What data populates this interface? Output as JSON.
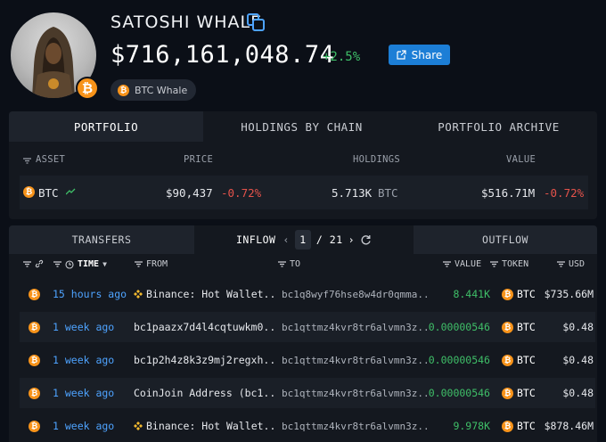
{
  "entity": {
    "name": "SATOSHI WHALE",
    "balance": "$716,161,048.74",
    "change": "+2.5%",
    "share_label": "Share",
    "tag_label": "BTC Whale",
    "avatar_badge": "₿"
  },
  "portfolio_tabs": [
    "PORTFOLIO",
    "HOLDINGS BY CHAIN",
    "PORTFOLIO ARCHIVE"
  ],
  "portfolio_headers": {
    "asset": "ASSET",
    "price": "PRICE",
    "holdings": "HOLDINGS",
    "value": "VALUE"
  },
  "portfolio_row": {
    "symbol": "BTC",
    "price": "$90,437",
    "price_change": "-0.72%",
    "holdings_amount": "5.713K",
    "holdings_unit": "BTC",
    "value": "$516.71M",
    "value_change": "-0.72%"
  },
  "transfer_tabs": {
    "transfers": "TRANSFERS",
    "inflow": "INFLOW",
    "outflow": "OUTFLOW",
    "page_current": "1",
    "page_total": "/ 21"
  },
  "table_headers": {
    "time": "TIME",
    "from": "FROM",
    "to": "TO",
    "value": "VALUE",
    "token": "TOKEN",
    "usd": "USD"
  },
  "transfers": [
    {
      "time": "15 hours ago",
      "from": "Binance: Hot Wallet...",
      "from_binance": true,
      "to": "bc1q8wyf76hse8w4dr0qmma...",
      "value": "8.441K",
      "token": "BTC",
      "usd": "$735.66M"
    },
    {
      "time": "1 week ago",
      "from": "bc1paazx7d4l4cqtuwkm0...",
      "from_binance": false,
      "to": "bc1qttmz4kvr8tr6alvmn3z...",
      "value": "0.00000546",
      "token": "BTC",
      "usd": "$0.48"
    },
    {
      "time": "1 week ago",
      "from": "bc1p2h4z8k3z9mj2regxh...",
      "from_binance": false,
      "to": "bc1qttmz4kvr8tr6alvmn3z...",
      "value": "0.00000546",
      "token": "BTC",
      "usd": "$0.48"
    },
    {
      "time": "1 week ago",
      "from": "CoinJoin Address (bc1...",
      "from_binance": false,
      "to": "bc1qttmz4kvr8tr6alvmn3z...",
      "value": "0.00000546",
      "token": "BTC",
      "usd": "$0.48"
    },
    {
      "time": "1 week ago",
      "from": "Binance: Hot Wallet...",
      "from_binance": true,
      "to": "bc1qttmz4kvr8tr6alvmn3z...",
      "value": "9.978K",
      "token": "BTC",
      "usd": "$878.46M"
    }
  ],
  "colors": {
    "background": "#0b0f17",
    "accent": "#1c7ed6",
    "positive": "#3fbf68",
    "negative": "#e5534b",
    "link": "#4ea3ff",
    "bitcoin": "#f7931a"
  }
}
